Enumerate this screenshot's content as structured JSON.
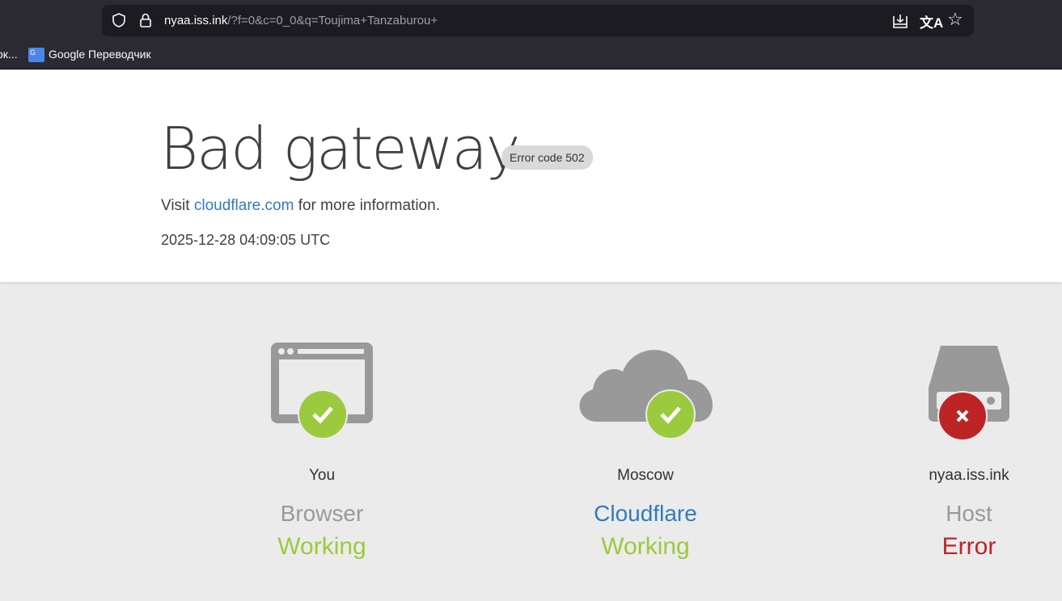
{
  "browser": {
    "url_host": "nyaa.iss.ink",
    "url_path": "/?f=0&c=0_0&q=Toujima+Tanzaburou+",
    "url_prefix": "nyaa.",
    "bookmarks": [
      {
        "label": "ок..."
      },
      {
        "label": "Google Переводчик"
      }
    ]
  },
  "error": {
    "title": "Bad gateway",
    "code_label": "Error code 502",
    "visit_prefix": "Visit",
    "visit_link": "cloudflare.com",
    "visit_suffix": "for more information.",
    "timestamp": "2025-12-28 04:09:05 UTC"
  },
  "nodes": [
    {
      "location": "You",
      "kind": "Browser",
      "status": "Working",
      "ok": true
    },
    {
      "location": "Moscow",
      "kind": "Cloudflare",
      "status": "Working",
      "ok": true
    },
    {
      "location": "nyaa.iss.ink",
      "kind": "Host",
      "status": "Error",
      "ok": false
    }
  ],
  "colors": {
    "ok": "#9bca3e",
    "error": "#bd2426",
    "link": "#2f7bbf"
  }
}
